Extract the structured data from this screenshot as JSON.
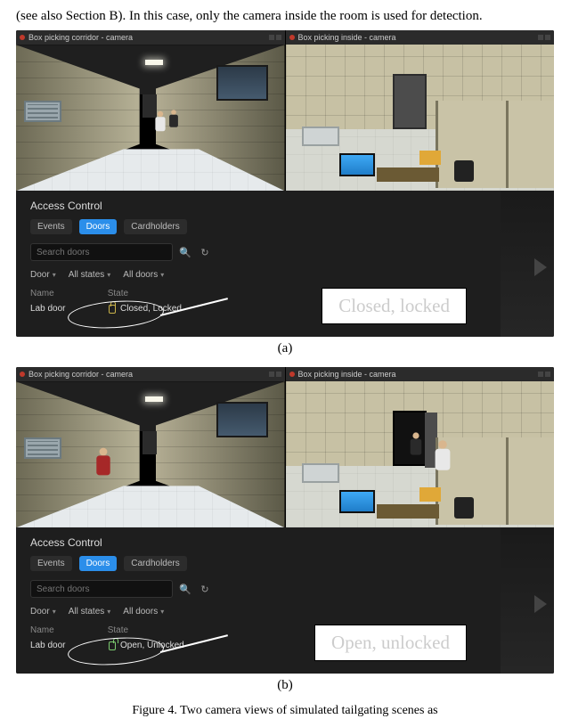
{
  "pre_text": "(see also Section B). In this case, only the camera inside the room is used for detection.",
  "panel_a": {
    "view_left_title": "Box picking corridor - camera",
    "view_right_title": "Box picking inside - camera",
    "ac": {
      "title": "Access Control",
      "tabs": {
        "events": "Events",
        "doors": "Doors",
        "cardholders": "Cardholders"
      },
      "search_placeholder": "Search doors",
      "filters": {
        "door": "Door",
        "states": "All states",
        "doors": "All doors"
      },
      "columns": {
        "name": "Name",
        "state": "State"
      },
      "row": {
        "name": "Lab door",
        "state": "Closed, Locked"
      }
    },
    "callout": "Closed, locked",
    "caption": "(a)"
  },
  "panel_b": {
    "view_left_title": "Box picking corridor - camera",
    "view_right_title": "Box picking inside - camera",
    "ac": {
      "title": "Access Control",
      "tabs": {
        "events": "Events",
        "doors": "Doors",
        "cardholders": "Cardholders"
      },
      "search_placeholder": "Search doors",
      "filters": {
        "door": "Door",
        "states": "All states",
        "doors": "All doors"
      },
      "columns": {
        "name": "Name",
        "state": "State"
      },
      "row": {
        "name": "Lab door",
        "state": "Open, Unlocked"
      }
    },
    "callout": "Open, unlocked",
    "caption": "(b)"
  },
  "main_caption": "Figure 4.    Two camera views of simulated tailgating scenes as"
}
